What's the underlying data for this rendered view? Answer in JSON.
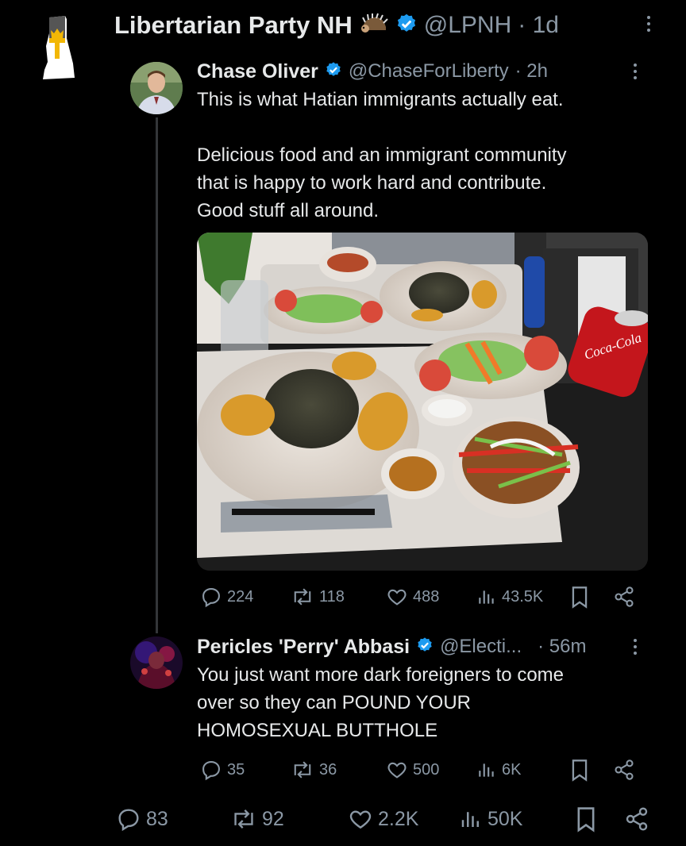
{
  "main_tweet": {
    "display_name": "Libertarian Party NH",
    "handle": "@LPNH",
    "time": "· 1d",
    "stats": {
      "replies": "83",
      "reposts": "92",
      "likes": "2.2K",
      "views": "50K"
    }
  },
  "quoted_tweet": {
    "display_name": "Chase Oliver",
    "handle": "@ChaseForLiberty",
    "time": "· 2h",
    "text_line1": "This is what Hatian immigrants actually eat.",
    "text_body": "Delicious food and an immigrant community\nthat is happy to work hard and contribute.\nGood stuff all around.",
    "can_label": "Coca-Cola",
    "stats": {
      "replies": "224",
      "reposts": "118",
      "likes": "488",
      "views": "43.5K"
    }
  },
  "reply_tweet": {
    "display_name": "Pericles 'Perry' Abbasi",
    "handle": "@Electi...",
    "time": "· 56m",
    "text": "You just want more dark foreigners to come\nover so they can POUND YOUR\nHOMOSEXUAL BUTTHOLE",
    "stats": {
      "replies": "35",
      "reposts": "36",
      "likes": "500",
      "views": "6K"
    }
  },
  "colors": {
    "verified": "#1d9bf0",
    "muted": "#8b98a5",
    "text": "#e7e9ea",
    "background": "#000000"
  }
}
